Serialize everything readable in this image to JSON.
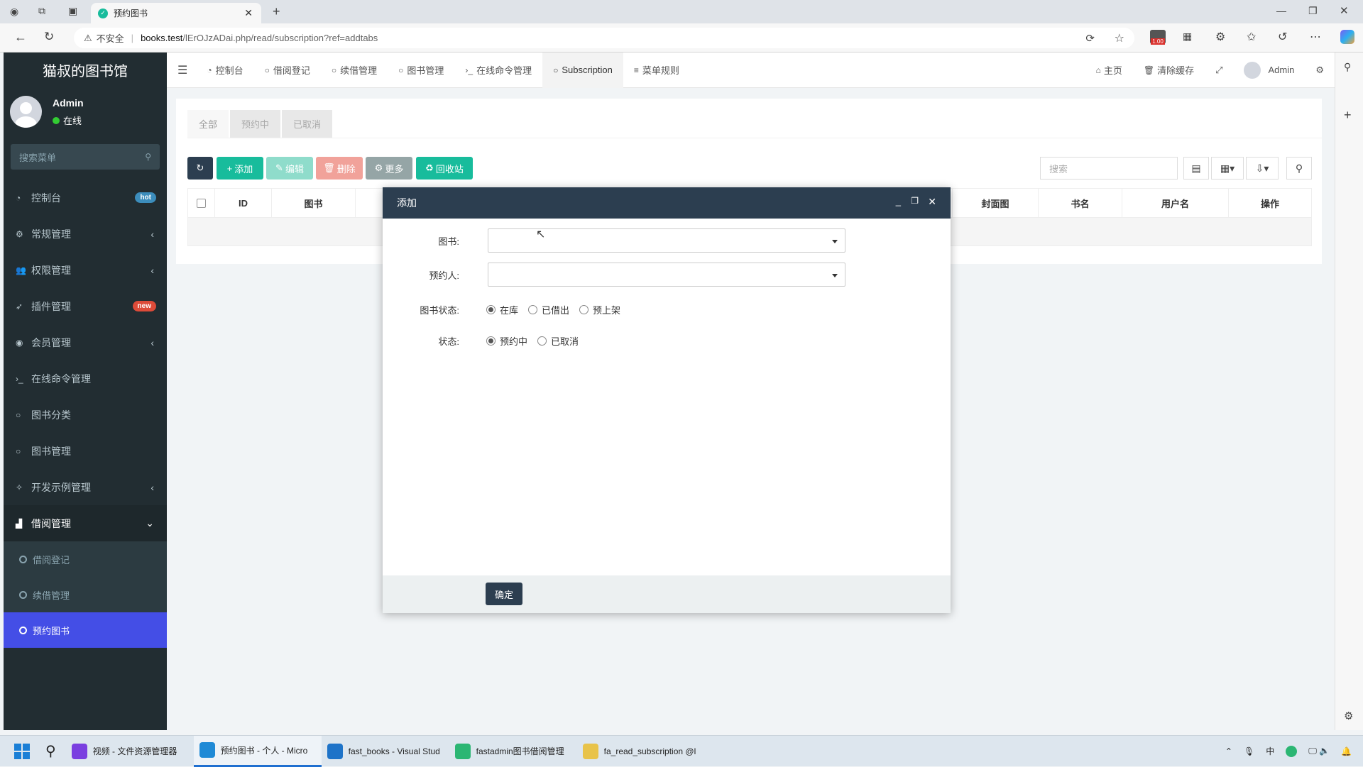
{
  "browser": {
    "tab_title": "预约图书",
    "security_label": "不安全",
    "url_host": "books.test",
    "url_path": "/lErOJzADai.php/read/subscription?ref=addtabs",
    "download_badge": "1.00"
  },
  "sidebar": {
    "logo": "猫叔的图书馆",
    "user_name": "Admin",
    "user_status": "在线",
    "search_placeholder": "搜索菜单",
    "items": [
      {
        "label": "控制台",
        "icon": "dashboard-icon",
        "badge": "hot",
        "badge_color": "#3c8dbc"
      },
      {
        "label": "常规管理",
        "icon": "cogs-icon",
        "arrow": "‹"
      },
      {
        "label": "权限管理",
        "icon": "group-icon",
        "arrow": "‹"
      },
      {
        "label": "插件管理",
        "icon": "rocket-icon",
        "badge": "new",
        "badge_color": "#dd4b39"
      },
      {
        "label": "会员管理",
        "icon": "user-circle-icon",
        "arrow": "‹"
      },
      {
        "label": "在线命令管理",
        "icon": "terminal-icon"
      },
      {
        "label": "图书分类",
        "icon": "circle-icon"
      },
      {
        "label": "图书管理",
        "icon": "circle-icon"
      },
      {
        "label": "开发示例管理",
        "icon": "magic-icon",
        "arrow": "‹"
      }
    ],
    "active_group": {
      "label": "借阅管理",
      "icon": "area-chart-icon",
      "arrow": "⌄"
    },
    "sub_items": [
      "借阅登记",
      "续借管理",
      "预约图书"
    ]
  },
  "topnav": {
    "tabs": [
      {
        "label": "控制台",
        "icon": "dashboard-icon"
      },
      {
        "label": "借阅登记",
        "icon": "circle-icon"
      },
      {
        "label": "续借管理",
        "icon": "circle-icon"
      },
      {
        "label": "图书管理",
        "icon": "circle-icon"
      },
      {
        "label": "在线命令管理",
        "icon": "terminal-icon"
      },
      {
        "label": "Subscription",
        "icon": "circle-icon"
      },
      {
        "label": "菜单规则",
        "icon": "list-icon"
      }
    ],
    "home": "主页",
    "clear_cache": "清除缓存",
    "admin": "Admin"
  },
  "content": {
    "tabs": [
      "全部",
      "预约中",
      "已取消"
    ],
    "toolbar": {
      "add": "添加",
      "edit": "编辑",
      "delete": "删除",
      "more": "更多",
      "recycle": "回收站"
    },
    "search_placeholder": "搜索",
    "columns_left": [
      "ID",
      "图书"
    ],
    "columns_right": [
      "封面图",
      "书名",
      "用户名",
      "操作"
    ]
  },
  "dialog": {
    "title": "添加",
    "fields": {
      "book_label": "图书:",
      "reserver_label": "预约人:",
      "book_status_label": "图书状态:",
      "book_status_options": [
        "在库",
        "已借出",
        "预上架"
      ],
      "status_label": "状态:",
      "status_options": [
        "预约中",
        "已取消"
      ]
    },
    "confirm": "确定"
  },
  "taskbar": {
    "apps": [
      {
        "label": "视频 - 文件资源管理器",
        "color": "#7a3fe0"
      },
      {
        "label": "预约图书 - 个人 - Micro",
        "color": "#1f8ad6"
      },
      {
        "label": "fast_books - Visual Stud",
        "color": "#1e73c8"
      },
      {
        "label": "fastadmin图书借阅管理",
        "color": "#2bb673"
      },
      {
        "label": "fa_read_subscription @l",
        "color": "#e8c34a"
      }
    ],
    "ime": "中"
  }
}
